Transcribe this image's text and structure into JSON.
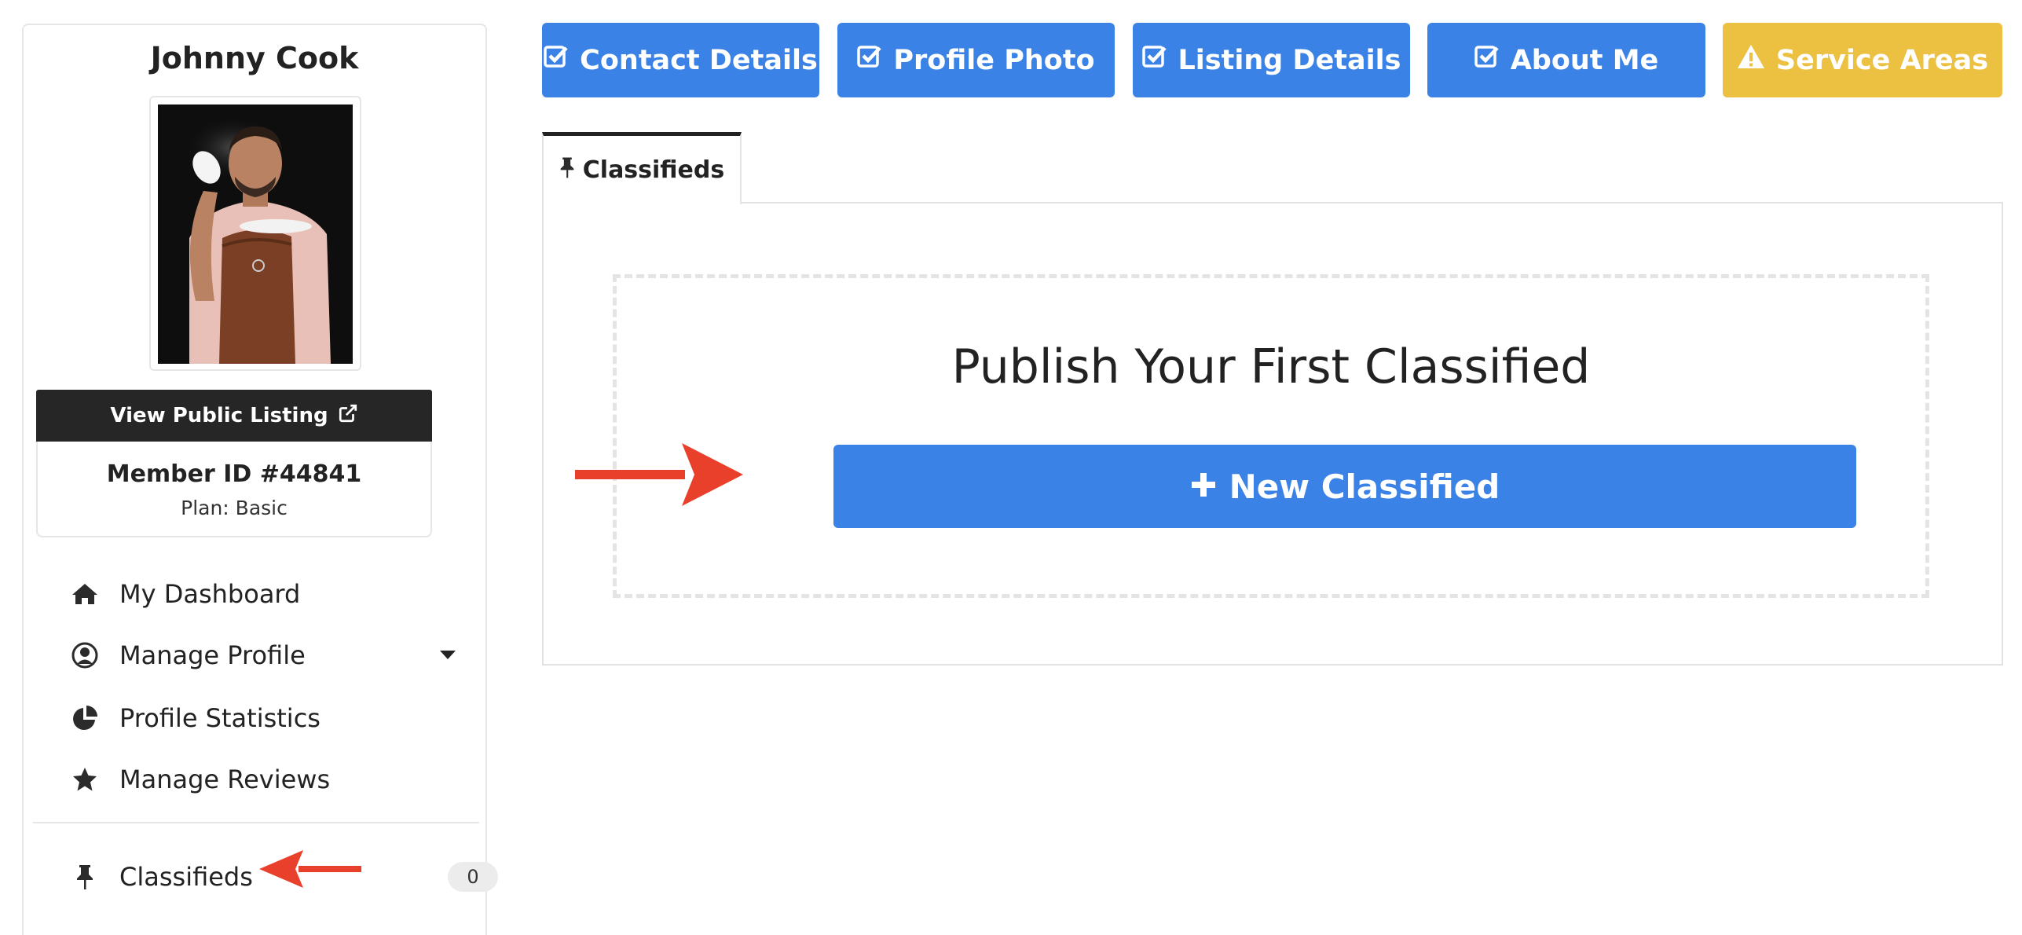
{
  "profile": {
    "name": "Johnny Cook",
    "view_public_label": "View Public Listing",
    "member_id": "Member ID #44841",
    "plan": "Plan: Basic"
  },
  "nav": {
    "items": [
      {
        "label": "My Dashboard",
        "icon": "home-icon"
      },
      {
        "label": "Manage Profile",
        "icon": "user-circle-icon"
      },
      {
        "label": "Profile Statistics",
        "icon": "pie-chart-icon"
      },
      {
        "label": "Manage Reviews",
        "icon": "star-icon"
      },
      {
        "label": "Classifieds",
        "icon": "pushpin-icon",
        "count": "0"
      }
    ]
  },
  "steps": [
    {
      "label": "Contact Details",
      "icon": "checkbox-icon",
      "color": "#3b82e6"
    },
    {
      "label": "Profile Photo",
      "icon": "checkbox-icon",
      "color": "#3b82e6"
    },
    {
      "label": "Listing Details",
      "icon": "checkbox-icon",
      "color": "#3b82e6"
    },
    {
      "label": "About Me",
      "icon": "checkbox-icon",
      "color": "#3b82e6"
    },
    {
      "label": "Service Areas",
      "icon": "warning-icon",
      "color": "#ecc142"
    }
  ],
  "tab": {
    "label": "Classifieds",
    "icon": "pushpin-icon"
  },
  "main": {
    "publish_title": "Publish Your First Classified",
    "new_button_label": "New Classified"
  },
  "colors": {
    "primary": "#3b82e6",
    "warning": "#ecc142",
    "dark": "#262626",
    "annotation_arrow": "#e8402a"
  }
}
